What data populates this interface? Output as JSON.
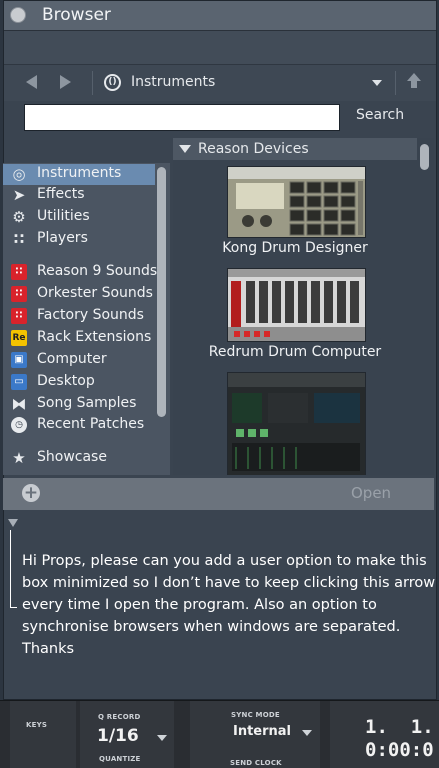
{
  "window": {
    "title": "Browser"
  },
  "nav": {
    "location": "Instruments",
    "location_icon": "reason-icon"
  },
  "search": {
    "value": "",
    "placeholder": "",
    "button": "Search"
  },
  "sidebar": {
    "items": [
      {
        "label": "Instruments",
        "icon": "instruments-icon",
        "selected": true
      },
      {
        "label": "Effects",
        "icon": "effects-icon"
      },
      {
        "label": "Utilities",
        "icon": "utilities-icon"
      },
      {
        "label": "Players",
        "icon": "players-icon"
      },
      {
        "label": "Reason 9 Sounds",
        "icon": "reason-sounds-icon"
      },
      {
        "label": "Orkester Sounds",
        "icon": "orkester-sounds-icon"
      },
      {
        "label": "Factory Sounds",
        "icon": "factory-sounds-icon"
      },
      {
        "label": "Rack Extensions",
        "icon": "rack-extensions-icon"
      },
      {
        "label": "Computer",
        "icon": "computer-icon"
      },
      {
        "label": "Desktop",
        "icon": "desktop-icon"
      },
      {
        "label": "Song Samples",
        "icon": "song-samples-icon"
      },
      {
        "label": "Recent Patches",
        "icon": "recent-patches-icon"
      },
      {
        "label": "Showcase",
        "icon": "star-icon"
      }
    ]
  },
  "content": {
    "section": "Reason Devices",
    "devices": [
      {
        "label": "Kong Drum Designer"
      },
      {
        "label": "Redrum Drum Computer"
      },
      {
        "label": ""
      }
    ]
  },
  "footer": {
    "open_button": "Open"
  },
  "annotation": "Hi Props, please can you add a user option to make this box minimized so I don’t have to keep clicking this arrow every time I open the program. Also an option to synchronise browsers when windows are separated. Thanks",
  "transport": {
    "keys_label": "KEYS",
    "q_record_label": "Q RECORD",
    "quantize_value": "1/16",
    "quantize_label": "QUANTIZE",
    "sync_mode_label": "SYNC MODE",
    "sync_mode_value": "Internal",
    "send_clock_label": "SEND CLOCK",
    "position": "1.  1.",
    "time": "0:00:0"
  }
}
